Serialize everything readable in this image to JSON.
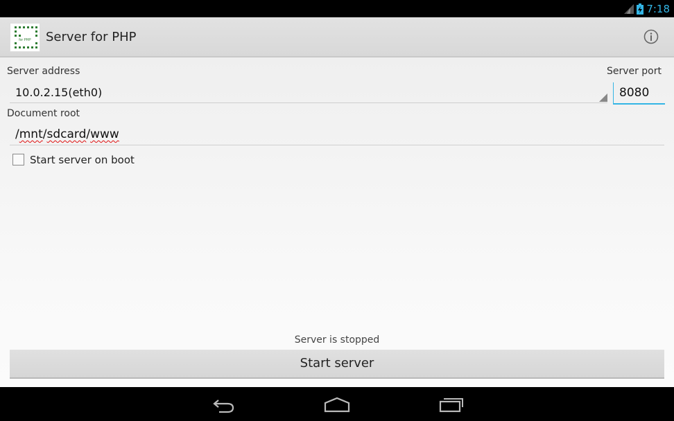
{
  "status_bar": {
    "time": "7:18"
  },
  "action_bar": {
    "title": "Server for PHP",
    "icon_caption": "for PHP"
  },
  "form": {
    "server_address_label": "Server address",
    "server_address_value": "10.0.2.15(eth0)",
    "server_port_label": "Server port",
    "server_port_value": "8080",
    "document_root_label": "Document root",
    "document_root_parts": [
      "/",
      "mnt",
      "/",
      "sdcard",
      "/",
      "www"
    ],
    "start_on_boot_label": "Start server on boot",
    "start_on_boot_checked": false
  },
  "footer": {
    "status_text": "Server is stopped",
    "start_button_label": "Start server"
  },
  "colors": {
    "accent": "#33b5e5",
    "spell_error": "#e01010"
  },
  "icons": [
    "signal-icon",
    "battery-icon",
    "info-icon",
    "back-icon",
    "home-icon",
    "recents-icon"
  ]
}
